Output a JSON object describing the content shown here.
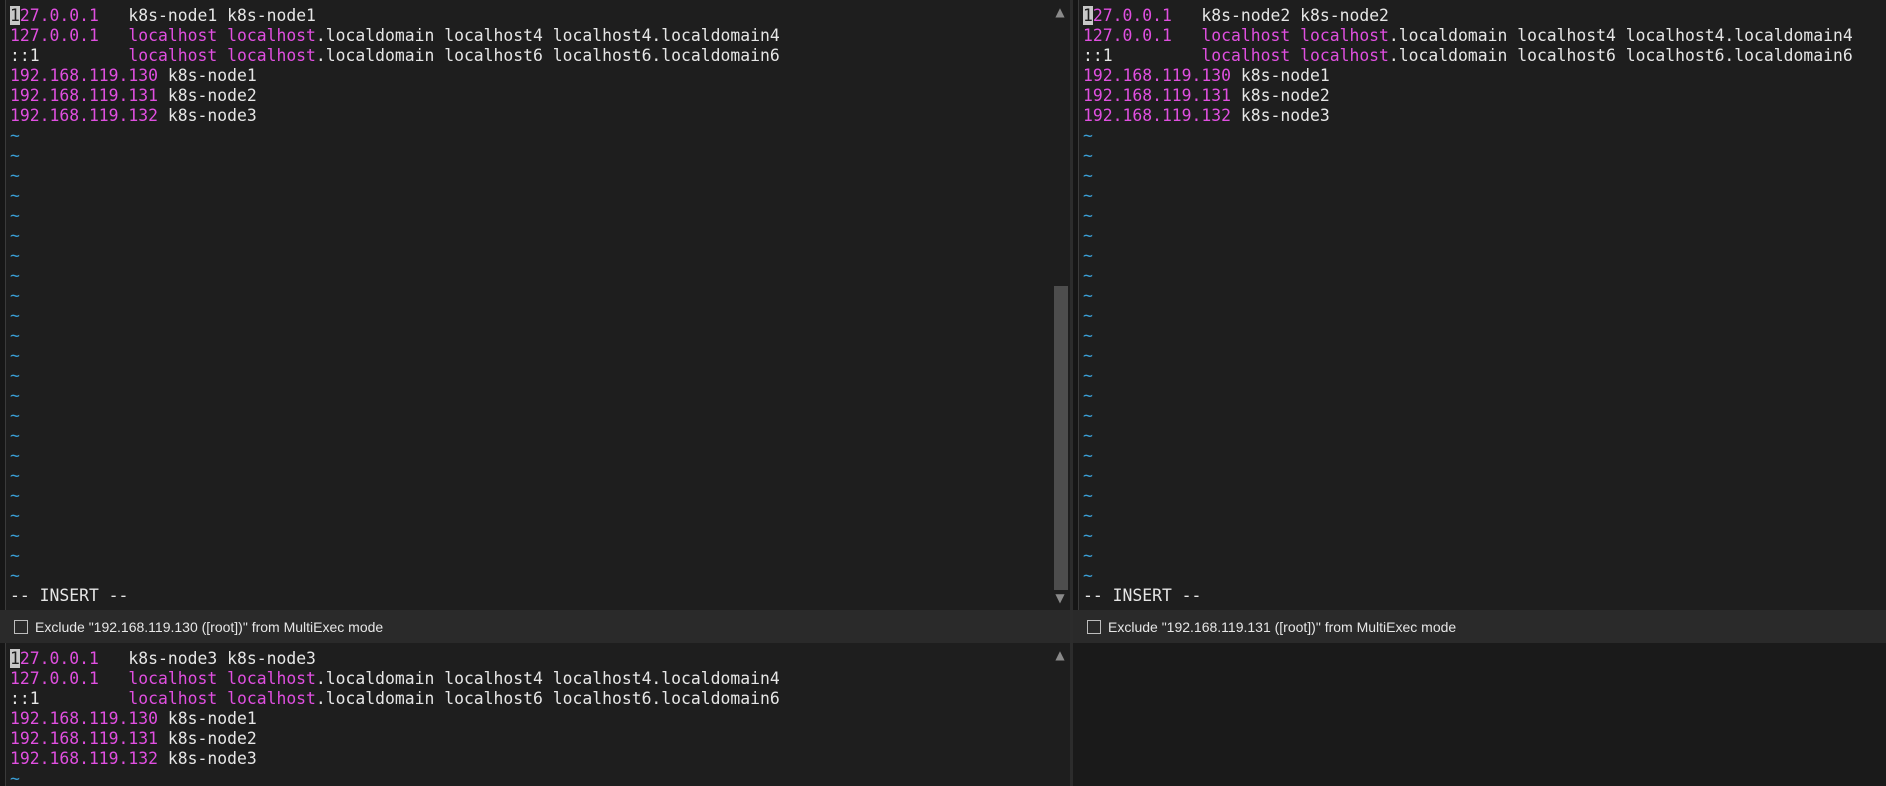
{
  "panes": {
    "node1": {
      "lines": [
        {
          "parts": [
            {
              "t": "1",
              "c": "cursor"
            },
            {
              "t": "27.0.0.1",
              "c": "mag"
            },
            {
              "t": "   k8s-node1 k8s-node1",
              "c": ""
            }
          ]
        },
        {
          "parts": [
            {
              "t": "127.0.0.1",
              "c": "mag"
            },
            {
              "t": "   ",
              "c": ""
            },
            {
              "t": "localhost",
              "c": "mag"
            },
            {
              "t": " ",
              "c": ""
            },
            {
              "t": "localhost",
              "c": "mag"
            },
            {
              "t": ".localdomain localhost4 localhost4.localdomain4",
              "c": ""
            }
          ]
        },
        {
          "parts": [
            {
              "t": "::1",
              "c": ""
            },
            {
              "t": "         ",
              "c": ""
            },
            {
              "t": "localhost",
              "c": "mag"
            },
            {
              "t": " ",
              "c": ""
            },
            {
              "t": "localhost",
              "c": "mag"
            },
            {
              "t": ".localdomain localhost6 localhost6.localdomain6",
              "c": ""
            }
          ]
        },
        {
          "parts": [
            {
              "t": "192.168.119.130",
              "c": "mag"
            },
            {
              "t": " k8s-node1",
              "c": ""
            }
          ]
        },
        {
          "parts": [
            {
              "t": "192.168.119.131",
              "c": "mag"
            },
            {
              "t": " k8s-node2",
              "c": ""
            }
          ]
        },
        {
          "parts": [
            {
              "t": "192.168.119.132",
              "c": "mag"
            },
            {
              "t": " k8s-node3",
              "c": ""
            }
          ]
        }
      ],
      "tildes": 23,
      "mode": "-- INSERT --"
    },
    "node2": {
      "lines": [
        {
          "parts": [
            {
              "t": "1",
              "c": "cursor"
            },
            {
              "t": "27.0.0.1",
              "c": "mag"
            },
            {
              "t": "   k8s-node2 k8s-node2",
              "c": ""
            }
          ]
        },
        {
          "parts": [
            {
              "t": "127.0.0.1",
              "c": "mag"
            },
            {
              "t": "   ",
              "c": ""
            },
            {
              "t": "localhost",
              "c": "mag"
            },
            {
              "t": " ",
              "c": ""
            },
            {
              "t": "localhost",
              "c": "mag"
            },
            {
              "t": ".localdomain localhost4 localhost4.localdomain4",
              "c": ""
            }
          ]
        },
        {
          "parts": [
            {
              "t": "::1",
              "c": ""
            },
            {
              "t": "         ",
              "c": ""
            },
            {
              "t": "localhost",
              "c": "mag"
            },
            {
              "t": " ",
              "c": ""
            },
            {
              "t": "localhost",
              "c": "mag"
            },
            {
              "t": ".localdomain localhost6 localhost6.localdomain6",
              "c": ""
            }
          ]
        },
        {
          "parts": [
            {
              "t": "192.168.119.130",
              "c": "mag"
            },
            {
              "t": " k8s-node1",
              "c": ""
            }
          ]
        },
        {
          "parts": [
            {
              "t": "192.168.119.131",
              "c": "mag"
            },
            {
              "t": " k8s-node2",
              "c": ""
            }
          ]
        },
        {
          "parts": [
            {
              "t": "192.168.119.132",
              "c": "mag"
            },
            {
              "t": " k8s-node3",
              "c": ""
            }
          ]
        }
      ],
      "tildes": 23,
      "mode": "-- INSERT --"
    },
    "node3": {
      "lines": [
        {
          "parts": [
            {
              "t": "1",
              "c": "cursor"
            },
            {
              "t": "27.0.0.1",
              "c": "mag"
            },
            {
              "t": "   k8s-node3 k8s-node3",
              "c": ""
            }
          ]
        },
        {
          "parts": [
            {
              "t": "127.0.0.1",
              "c": "mag"
            },
            {
              "t": "   ",
              "c": ""
            },
            {
              "t": "localhost",
              "c": "mag"
            },
            {
              "t": " ",
              "c": ""
            },
            {
              "t": "localhost",
              "c": "mag"
            },
            {
              "t": ".localdomain localhost4 localhost4.localdomain4",
              "c": ""
            }
          ]
        },
        {
          "parts": [
            {
              "t": "::1",
              "c": ""
            },
            {
              "t": "         ",
              "c": ""
            },
            {
              "t": "localhost",
              "c": "mag"
            },
            {
              "t": " ",
              "c": ""
            },
            {
              "t": "localhost",
              "c": "mag"
            },
            {
              "t": ".localdomain localhost6 localhost6.localdomain6",
              "c": ""
            }
          ]
        },
        {
          "parts": [
            {
              "t": "192.168.119.130",
              "c": "mag"
            },
            {
              "t": " k8s-node1",
              "c": ""
            }
          ]
        },
        {
          "parts": [
            {
              "t": "192.168.119.131",
              "c": "mag"
            },
            {
              "t": " k8s-node2",
              "c": ""
            }
          ]
        },
        {
          "parts": [
            {
              "t": "192.168.119.132",
              "c": "mag"
            },
            {
              "t": " k8s-node3",
              "c": ""
            }
          ]
        }
      ],
      "tildes": 1,
      "mode": ""
    }
  },
  "multiexec": {
    "left_label": "Exclude \"192.168.119.130 ([root])\" from MultiExec mode",
    "right_label": "Exclude \"192.168.119.131 ([root])\" from MultiExec mode"
  },
  "icons": {
    "scroll_up": "chevron-up-icon",
    "scroll_down": "chevron-down-icon",
    "checkbox": "checkbox-icon"
  },
  "colors": {
    "background": "#1e1e1e",
    "highlight": "#e04fe0",
    "tilde": "#3aa0d8",
    "text": "#e6e6e6"
  }
}
